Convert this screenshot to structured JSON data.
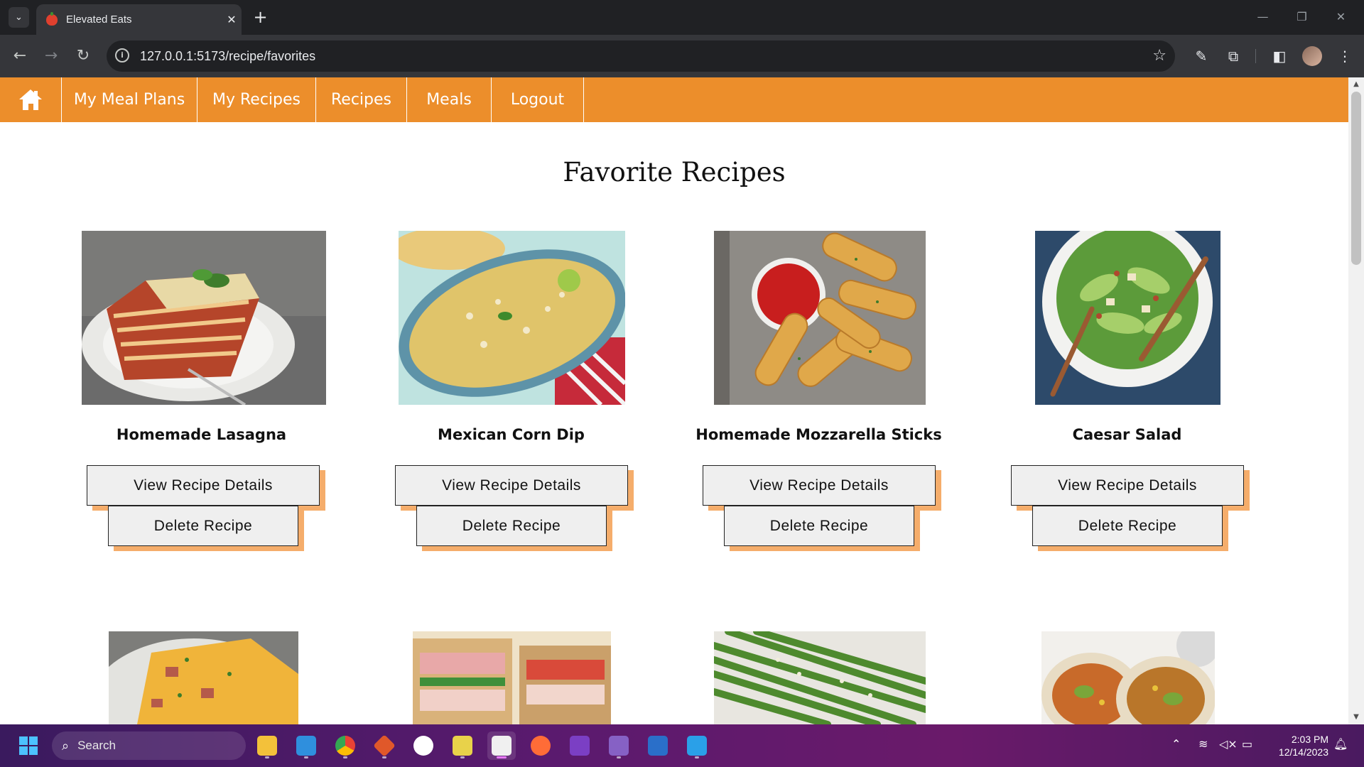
{
  "browser": {
    "tab_title": "Elevated Eats",
    "url": "127.0.0.1:5173/recipe/favorites",
    "tab_close": "✕",
    "new_tab": "+"
  },
  "appnav": {
    "links": [
      "My Meal Plans",
      "My Recipes",
      "Recipes",
      "Meals",
      "Logout"
    ]
  },
  "page": {
    "title": "Favorite Recipes",
    "view_label": "View Recipe Details",
    "delete_label": "Delete Recipe"
  },
  "recipes": [
    {
      "name": "Homemade Lasagna",
      "image": "lasagna"
    },
    {
      "name": "Mexican Corn Dip",
      "image": "corn-dip"
    },
    {
      "name": "Homemade Mozzarella Sticks",
      "image": "mozzarella-sticks"
    },
    {
      "name": "Caesar Salad",
      "image": "caesar-salad"
    },
    {
      "name": "",
      "image": "omelette"
    },
    {
      "name": "",
      "image": "club-sandwich"
    },
    {
      "name": "",
      "image": "asparagus"
    },
    {
      "name": "",
      "image": "burrito-wrap"
    }
  ],
  "taskbar": {
    "search_label": "Search",
    "time": "2:03 PM",
    "date": "12/14/2023"
  },
  "colors": {
    "accent": "#ec8e2b",
    "shadow": "#f5ad6b"
  }
}
